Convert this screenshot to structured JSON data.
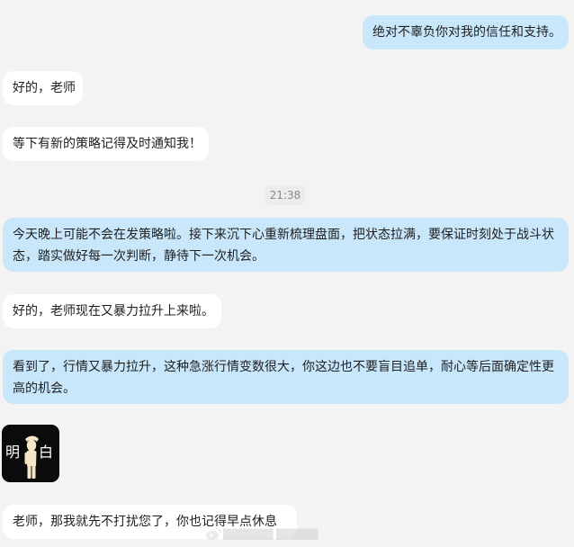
{
  "messages": [
    {
      "role": "out",
      "text": "绝对不辜负你对我的信任和支持。"
    },
    {
      "role": "in",
      "text": "好的，老师"
    },
    {
      "role": "in",
      "text": "等下有新的策略记得及时通知我！"
    },
    {
      "role": "out",
      "text": "今天晚上可能不会在发策略啦。接下来沉下心重新梳理盘面，把状态拉满，要保证时刻处于战斗状态，踏实做好每一次判断，静待下一次机会。"
    },
    {
      "role": "in",
      "text": "好的，老师现在又暴力拉升上来啦。"
    },
    {
      "role": "out",
      "text": "看到了，行情又暴力拉升，这种急涨行情变数很大，你这边也不要盲目追单，耐心等后面确定性更高的机会。"
    },
    {
      "role": "in",
      "text": "老师，那我就先不打扰您了，你也记得早点休息"
    }
  ],
  "timestamp": "21:38",
  "sticker": {
    "left_char": "明",
    "right_char": "白",
    "icon": "saluting-figure-icon"
  },
  "colors": {
    "background": "#f3f3f3",
    "outgoing_bubble": "#c9e7fb",
    "incoming_bubble": "#ffffff",
    "timestamp_bg": "#ececec",
    "timestamp_text": "#8a8a8a",
    "sticker_bg": "#0b0b0b"
  }
}
